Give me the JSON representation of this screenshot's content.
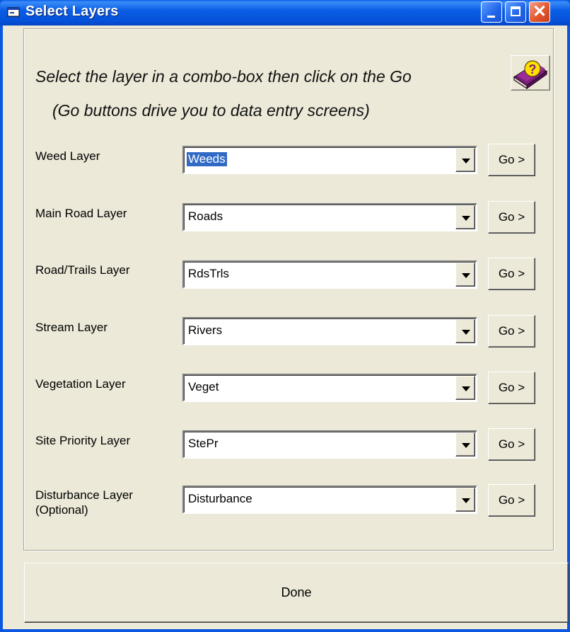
{
  "window": {
    "title": "Select Layers",
    "close_glyph": "✕"
  },
  "instructions": {
    "line1": "Select the layer in a combo-box then click on the Go",
    "line2": "(Go buttons drive you to data entry screens)"
  },
  "help": {
    "icon": "help-book-icon"
  },
  "layers": [
    {
      "label": "Weed Layer",
      "value": "Weeds",
      "go": "Go >"
    },
    {
      "label": "Main Road Layer",
      "value": "Roads",
      "go": "Go >"
    },
    {
      "label": "Road/Trails Layer",
      "value": "RdsTrls",
      "go": "Go >"
    },
    {
      "label": "Stream Layer",
      "value": "Rivers",
      "go": "Go >"
    },
    {
      "label": "Vegetation Layer",
      "value": "Veget",
      "go": "Go >"
    },
    {
      "label": "Site Priority Layer",
      "value": "StePr",
      "go": "Go >"
    },
    {
      "label": "Disturbance Layer",
      "label2": "(Optional)",
      "value": "Disturbance",
      "go": "Go >"
    }
  ],
  "done_label": "Done",
  "colors": {
    "titlebar": "#0a5fe8",
    "face": "#ece9d8",
    "selection": "#316ac5"
  }
}
